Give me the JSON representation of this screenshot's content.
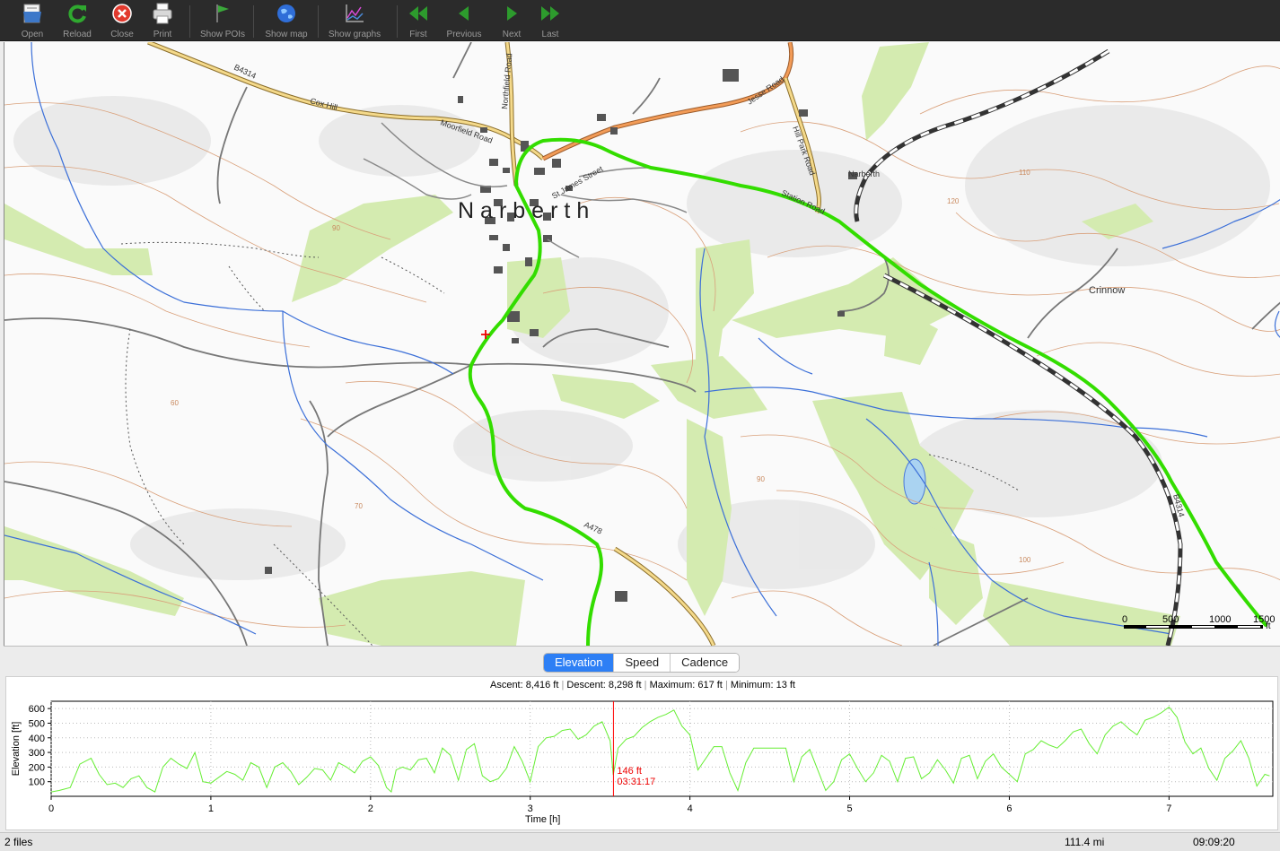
{
  "toolbar": {
    "buttons": [
      {
        "id": "open",
        "label": "Open",
        "icon": "folder-open-icon"
      },
      {
        "id": "reload",
        "label": "Reload",
        "icon": "reload-icon"
      },
      {
        "id": "close",
        "label": "Close",
        "icon": "close-icon"
      },
      {
        "id": "print",
        "label": "Print",
        "icon": "printer-icon"
      },
      {
        "id": "show_pois",
        "label": "Show POIs",
        "icon": "flag-icon"
      },
      {
        "id": "show_map",
        "label": "Show map",
        "icon": "globe-icon"
      },
      {
        "id": "show_graphs",
        "label": "Show graphs",
        "icon": "graph-icon"
      },
      {
        "id": "first",
        "label": "First",
        "icon": "double-left-arrow-icon"
      },
      {
        "id": "previous",
        "label": "Previous",
        "icon": "left-arrow-icon"
      },
      {
        "id": "next",
        "label": "Next",
        "icon": "right-arrow-icon"
      },
      {
        "id": "last",
        "label": "Last",
        "icon": "double-right-arrow-icon"
      }
    ]
  },
  "map": {
    "town_label": "Narberth",
    "labels": {
      "crinnow": "Crinnow",
      "narberth_station": "Narberth",
      "b4314_top": "B4314",
      "b4314_right": "B4314",
      "cox_hill": "Cox Hill",
      "moorfield_road": "Moorfield Road",
      "northfield_road": "Northfield Road",
      "jesse_road": "Jesse Road",
      "hill_park_road": "Hill Park Road",
      "station_road": "Station Road",
      "st_james_street": "St James Street",
      "a478": "A478",
      "contour_90_a": "90",
      "contour_60": "60",
      "contour_70": "70",
      "contour_90_b": "90",
      "contour_110": "110",
      "contour_120": "120",
      "contour_100": "100"
    },
    "scale": {
      "ticks": [
        "0",
        "500",
        "1000",
        "1500"
      ],
      "unit": "ft"
    },
    "track_color": "#33dd00"
  },
  "graph": {
    "tabs": [
      "Elevation",
      "Speed",
      "Cadence"
    ],
    "active_tab": "Elevation",
    "stats": {
      "ascent": "Ascent: 8,416 ft",
      "descent": "Descent: 8,298 ft",
      "maximum": "Maximum: 617 ft",
      "minimum": "Minimum: 13 ft"
    },
    "cursor": {
      "elevation_label": "146 ft",
      "time_label": "03:31:17",
      "time_h": 3.521,
      "color": "#ff0000"
    },
    "line_color": "#66ee33"
  },
  "chart_data": {
    "type": "line",
    "xlabel": "Time [h]",
    "ylabel": "Elevation [ft]",
    "xlim": [
      0,
      7.65
    ],
    "ylim": [
      0,
      650
    ],
    "x_ticks": [
      "0",
      "1",
      "2",
      "3",
      "4",
      "5",
      "6",
      "7"
    ],
    "y_ticks": [
      "100",
      "200",
      "300",
      "400",
      "500",
      "600"
    ],
    "grid": true,
    "series": [
      {
        "x": [
          0,
          0.05,
          0.12,
          0.18,
          0.25,
          0.3,
          0.35,
          0.4,
          0.45,
          0.5,
          0.55,
          0.6,
          0.65,
          0.7,
          0.75,
          0.8,
          0.85,
          0.9,
          0.95,
          1.0,
          1.05,
          1.1,
          1.15,
          1.2,
          1.25,
          1.3,
          1.35,
          1.4,
          1.45,
          1.5,
          1.55,
          1.6,
          1.65,
          1.7,
          1.75,
          1.8,
          1.85,
          1.9,
          1.95,
          2.0,
          2.05,
          2.1,
          2.13,
          2.16,
          2.2,
          2.25,
          2.3,
          2.35,
          2.4,
          2.45,
          2.5,
          2.55,
          2.6,
          2.65,
          2.7,
          2.75,
          2.8,
          2.85,
          2.9,
          2.95,
          3.0,
          3.05,
          3.1,
          3.15,
          3.2,
          3.25,
          3.3,
          3.35,
          3.4,
          3.45,
          3.5,
          3.52,
          3.55,
          3.6,
          3.65,
          3.7,
          3.75,
          3.8,
          3.85,
          3.9,
          3.95,
          4.0,
          4.05,
          4.1,
          4.15,
          4.2,
          4.25,
          4.3,
          4.35,
          4.4,
          4.45,
          4.5,
          4.55,
          4.6,
          4.65,
          4.7,
          4.75,
          4.8,
          4.85,
          4.9,
          4.95,
          5.0,
          5.05,
          5.1,
          5.15,
          5.2,
          5.25,
          5.3,
          5.35,
          5.4,
          5.45,
          5.5,
          5.55,
          5.6,
          5.65,
          5.7,
          5.75,
          5.8,
          5.85,
          5.9,
          5.95,
          6.0,
          6.05,
          6.1,
          6.15,
          6.2,
          6.25,
          6.3,
          6.35,
          6.4,
          6.45,
          6.5,
          6.55,
          6.6,
          6.65,
          6.7,
          6.75,
          6.8,
          6.85,
          6.9,
          6.95,
          7.0,
          7.05,
          7.1,
          7.15,
          7.2,
          7.25,
          7.3,
          7.35,
          7.4,
          7.45,
          7.5,
          7.55,
          7.6,
          7.63
        ],
        "y": [
          30,
          40,
          60,
          220,
          260,
          150,
          80,
          90,
          60,
          120,
          140,
          60,
          30,
          200,
          260,
          220,
          190,
          300,
          100,
          90,
          130,
          170,
          150,
          110,
          230,
          200,
          60,
          200,
          230,
          170,
          80,
          130,
          190,
          180,
          110,
          230,
          200,
          160,
          240,
          270,
          210,
          60,
          30,
          180,
          200,
          180,
          250,
          260,
          160,
          330,
          280,
          110,
          320,
          360,
          140,
          100,
          120,
          190,
          340,
          240,
          100,
          340,
          400,
          410,
          450,
          460,
          390,
          420,
          480,
          510,
          380,
          146,
          330,
          390,
          410,
          470,
          510,
          540,
          560,
          590,
          480,
          420,
          180,
          260,
          340,
          340,
          160,
          40,
          230,
          330,
          330,
          330,
          330,
          330,
          100,
          270,
          320,
          180,
          40,
          100,
          250,
          290,
          190,
          100,
          160,
          280,
          240,
          100,
          260,
          270,
          120,
          160,
          250,
          180,
          90,
          260,
          280,
          120,
          240,
          290,
          200,
          150,
          100,
          290,
          320,
          380,
          350,
          330,
          380,
          440,
          460,
          360,
          290,
          420,
          480,
          510,
          460,
          420,
          520,
          540,
          570,
          610,
          540,
          370,
          290,
          330,
          190,
          110,
          260,
          310,
          380,
          260,
          70,
          150,
          140
        ]
      }
    ]
  },
  "status": {
    "files": "2 files",
    "distance": "111.4 mi",
    "time": "09:09:20"
  }
}
